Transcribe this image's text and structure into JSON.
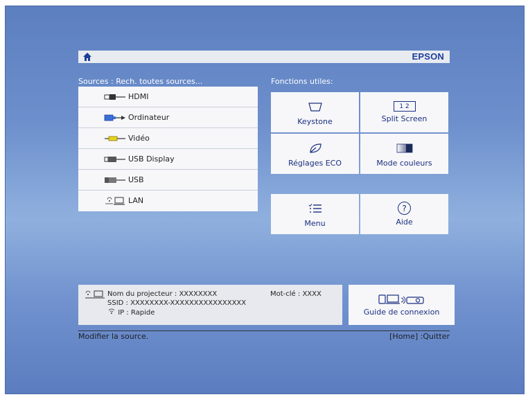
{
  "header": {
    "brand": "EPSON",
    "home_icon": "home-icon"
  },
  "sources": {
    "title": "Sources : Rech. toutes sources...",
    "items": [
      {
        "label": "HDMI",
        "icon": "hdmi-icon"
      },
      {
        "label": "Ordinateur",
        "icon": "computer-port-icon"
      },
      {
        "label": "Vidéo",
        "icon": "video-port-icon"
      },
      {
        "label": "USB Display",
        "icon": "usb-display-icon"
      },
      {
        "label": "USB",
        "icon": "usb-icon"
      },
      {
        "label": "LAN",
        "icon": "lan-icon"
      }
    ]
  },
  "functions": {
    "title": "Fonctions utiles:",
    "tiles": [
      {
        "label": "Keystone",
        "icon": "keystone-icon"
      },
      {
        "label": "Split Screen",
        "icon": "split-screen-icon",
        "icon_text": "1 2"
      },
      {
        "label": "Réglages ECO",
        "icon": "eco-leaf-icon"
      },
      {
        "label": "Mode couleurs",
        "icon": "color-mode-icon"
      },
      {
        "label": "Menu",
        "icon": "menu-icon"
      },
      {
        "label": "Aide",
        "icon": "help-icon",
        "icon_text": "?"
      }
    ]
  },
  "network_info": {
    "projector_name_label": "Nom du projecteur :",
    "projector_name_value": "XXXXXXXX",
    "keyword_label": "Mot-clé :",
    "keyword_value": "XXXX",
    "ssid_label": "SSID :",
    "ssid_value": "XXXXXXXX-XXXXXXXXXXXXXXXX",
    "ip_label": "IP :",
    "ip_value": "Rapide"
  },
  "guide": {
    "label": "Guide de connexion",
    "icon": "connection-guide-icon"
  },
  "status": {
    "left": "Modifier la source.",
    "right": "[Home] :Quitter"
  },
  "colors": {
    "background": "#6d8fcc",
    "panel": "#f7f7f9",
    "accent_text": "#1a2f80",
    "brand": "#1c3d9a"
  }
}
